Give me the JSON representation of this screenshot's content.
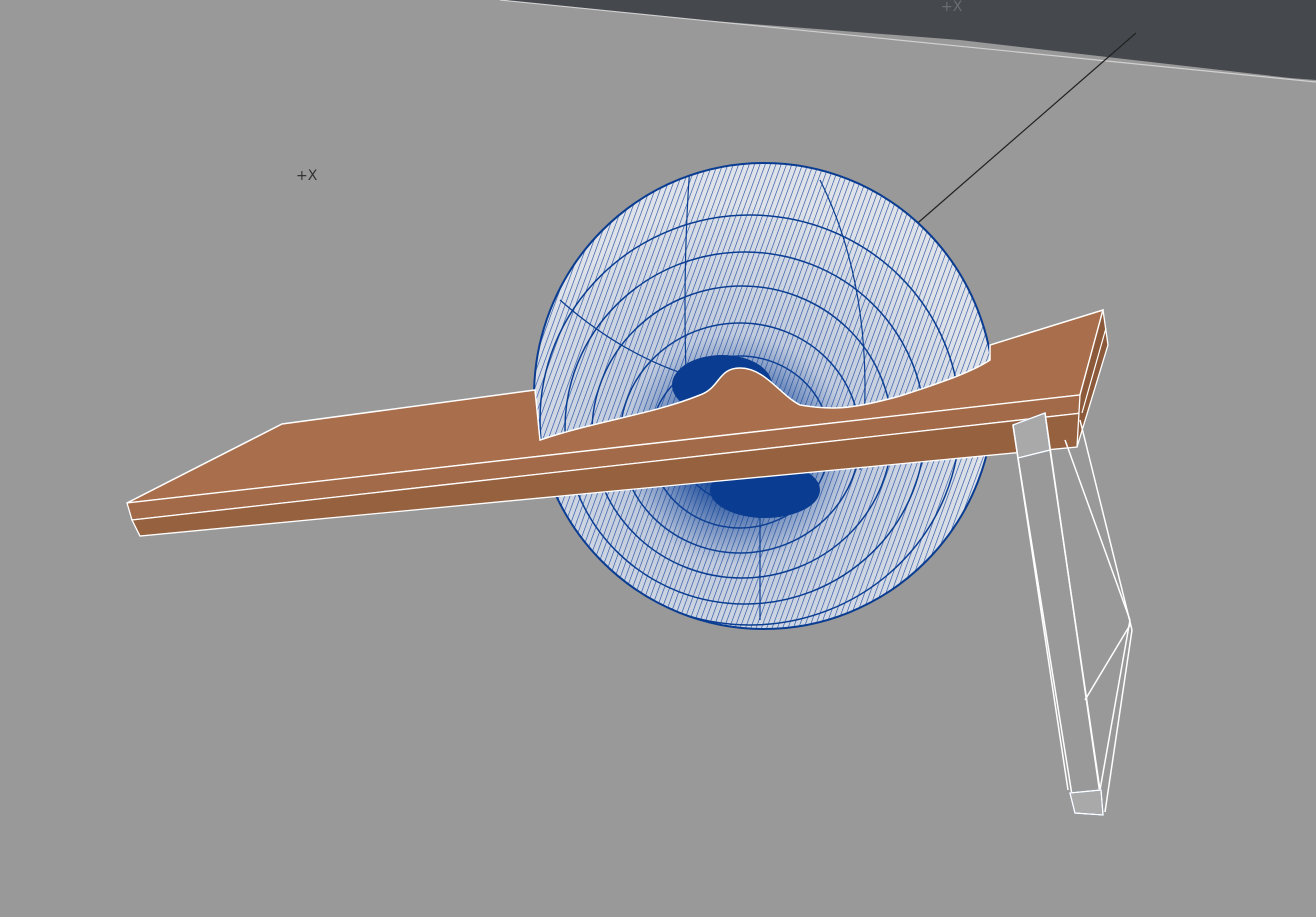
{
  "viewport": {
    "background": "#999999",
    "ground_plane_color": "#45494d",
    "sphere_wire_color": "#0a3d91",
    "sphere_fill_color": "#d8dbe2",
    "board_color": "#a96e4b",
    "board_side_color": "#96613f",
    "frame_color": "#ffffff",
    "axis_labels": {
      "left": "+X",
      "top": "+X"
    }
  }
}
